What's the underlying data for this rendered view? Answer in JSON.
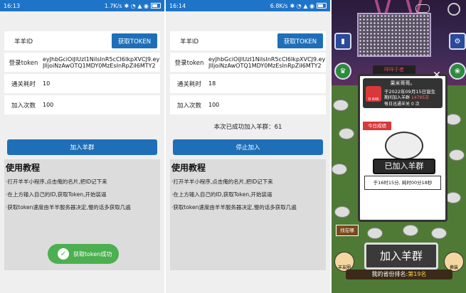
{
  "left_phone": {
    "status": {
      "time": "16:13",
      "speed": "1.7K/s",
      "icons": "✱ ◔ ▲ ◉"
    },
    "id_label": "羊羊ID",
    "get_token_label": "获取TOKEN",
    "token_label": "登录token",
    "token_value": "eyJhbGciOiJIUzI1NiIsInR5cCI6IkpXVCJ9.eyJlIjoiNzAwOTQ1MDY0MzEsInRpZiI6MTY2Mjk2",
    "time_label": "通关耗时",
    "time_value": "10",
    "count_label": "加入次数",
    "count_value": "100",
    "join_button": "加入羊群",
    "tutorial_title": "使用教程",
    "tutorial_lines": [
      "·打开羊羊小程序,点击俺的名片,把ID记下来",
      "·在上方输入自己的ID,获取Token,开始装逼",
      "·获取token速度由羊羊服务器决定,慢的话多获取几遍"
    ],
    "toast": "获取token成功"
  },
  "right_phone": {
    "status": {
      "time": "16:14",
      "speed": "6.8K/s",
      "icons": "✱ ◔ ▲ ◉"
    },
    "id_label": "羊羊ID",
    "get_token_label": "获取TOKEN",
    "token_label": "登录token",
    "token_value": "eyJhbGciOiJIUzI1NiIsInR5cCI6IkpXVCJ9.eyJlIjoiNzAwOTQ1MDY0MzEsInRpZiI6MTY2Mjk2",
    "time_label": "通关耗时",
    "time_value": "18",
    "count_label": "加入次数",
    "count_value": "100",
    "success_text": "本次已成功加入羊群：61",
    "stop_button": "停止加入",
    "tutorial_title": "使用教程",
    "tutorial_lines": [
      "·打开羊羊小程序,点击俺的名片,把ID记下来",
      "·在上方输入自己的ID,获取Token,开始装逼",
      "·获取token速度由羊羊服务器决定,慢的话多获取几遍"
    ]
  },
  "game": {
    "stage_sign": "咩咩于者",
    "popup": {
      "name": "果米哥哥。",
      "date": "于2022年09月15日诞生",
      "line1_prefix": "期间加入羊群",
      "line1_value": "14795次",
      "line2_prefix": "每日迅通羊关",
      "line2_value": "0 次",
      "avatar_text": "D 646",
      "today": "今日成绩",
      "joined": "已加入羊群",
      "time": "于16时15分, 耗时00分18秒"
    },
    "where_button": "找在哪",
    "join_button": "加入羊群",
    "rank_prefix": "我的省份排名:",
    "rank_value": "第19名",
    "left_bottom": "羊友圈",
    "right_bottom": "换装"
  }
}
